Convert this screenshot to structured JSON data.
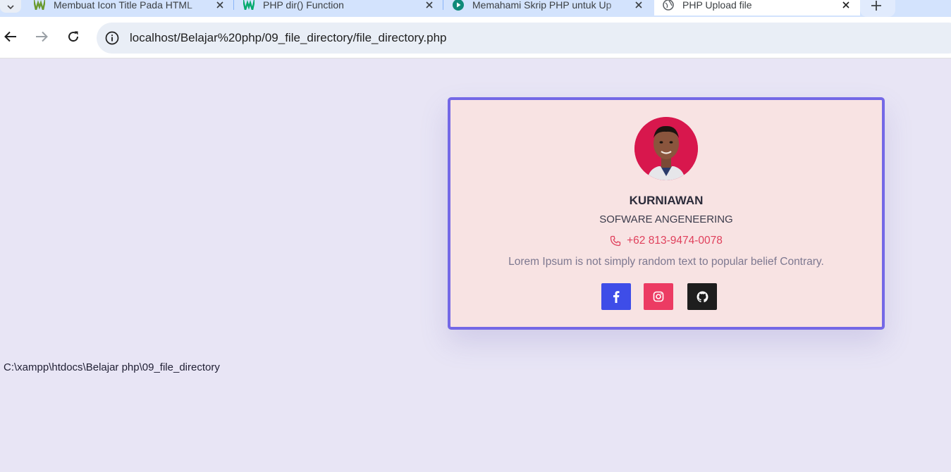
{
  "browser": {
    "tabs": [
      {
        "title": "Membuat Icon Title Pada HTML",
        "favicon": "w3-green-icon",
        "active": false
      },
      {
        "title": "PHP dir() Function",
        "favicon": "w3-green-icon",
        "active": false
      },
      {
        "title": "Memahami Skrip PHP untuk Up",
        "favicon": "teal-play-icon",
        "active": false
      },
      {
        "title": "PHP Upload file",
        "favicon": "globe-icon",
        "active": true
      }
    ],
    "url": "localhost/Belajar%20php/09_file_directory/file_directory.php"
  },
  "card": {
    "name": "KURNIAWAN",
    "role": "SOFWARE ANGENEERING",
    "phone": "+62 813-9474-0078",
    "description": "Lorem Ipsum is not simply random text to popular belief Contrary.",
    "socials": [
      {
        "name": "facebook",
        "color": "#3e4de8"
      },
      {
        "name": "instagram",
        "color": "#ec3b63"
      },
      {
        "name": "github",
        "color": "#1e1e1e"
      }
    ],
    "border_color": "#7468e6",
    "background": "#f8e3e3"
  },
  "page": {
    "directory_path": "C:\\xampp\\htdocs\\Belajar php\\09_file_directory",
    "background": "#e8e5f5"
  }
}
